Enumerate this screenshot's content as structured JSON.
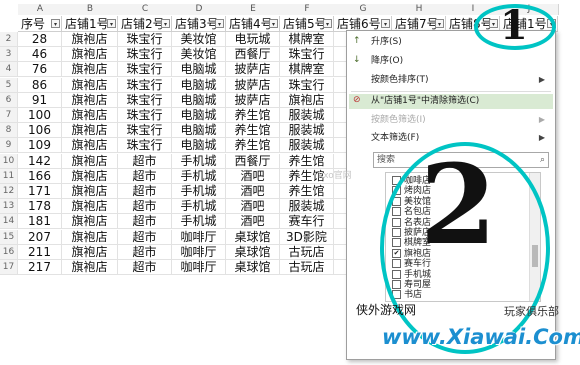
{
  "sheet": {
    "column_letters": [
      "A",
      "B",
      "C",
      "D",
      "E",
      "F",
      "G",
      "H",
      "I",
      "J"
    ],
    "headers": [
      "序号",
      "店铺1号",
      "店铺2号",
      "店铺3号",
      "店铺4号",
      "店铺5号",
      "店铺6号",
      "店铺7号",
      "店铺8号",
      "店铺1号"
    ],
    "row_numbers": [
      "2",
      "3",
      "4",
      "5",
      "6",
      "7",
      "8",
      "9",
      "10",
      "11",
      "12",
      "13",
      "14",
      "15",
      "16",
      "17"
    ],
    "rows": [
      [
        "28",
        "旗袍店",
        "珠宝行",
        "美妆馆",
        "电玩城",
        "棋牌室",
        "香"
      ],
      [
        "46",
        "旗袍店",
        "珠宝行",
        "美妆馆",
        "西餐厅",
        "珠宝行",
        "西"
      ],
      [
        "76",
        "旗袍店",
        "珠宝行",
        "电脑城",
        "披萨店",
        "棋牌室",
        "服"
      ],
      [
        "86",
        "旗袍店",
        "珠宝行",
        "电脑城",
        "披萨店",
        "珠宝行",
        "服"
      ],
      [
        "91",
        "旗袍店",
        "珠宝行",
        "电脑城",
        "披萨店",
        "旗袍店",
        "香"
      ],
      [
        "100",
        "旗袍店",
        "珠宝行",
        "电脑城",
        "养生馆",
        "服装城",
        "香"
      ],
      [
        "106",
        "旗袍店",
        "珠宝行",
        "电脑城",
        "养生馆",
        "服装城",
        "香"
      ],
      [
        "109",
        "旗袍店",
        "珠宝行",
        "电脑城",
        "养生馆",
        "服装城",
        "香"
      ],
      [
        "142",
        "旗袍店",
        "超市",
        "手机城",
        "西餐厅",
        "养生馆",
        "旗"
      ],
      [
        "166",
        "旗袍店",
        "超市",
        "手机城",
        "酒吧",
        "养生馆",
        "赛"
      ],
      [
        "171",
        "旗袍店",
        "超市",
        "手机城",
        "酒吧",
        "养生馆",
        "珠"
      ],
      [
        "178",
        "旗袍店",
        "超市",
        "手机城",
        "酒吧",
        "服装城",
        "珠"
      ],
      [
        "181",
        "旗袍店",
        "超市",
        "手机城",
        "酒吧",
        "赛车行",
        "珠"
      ],
      [
        "207",
        "旗袍店",
        "超市",
        "咖啡厅",
        "桌球馆",
        "3D影院",
        "棋"
      ],
      [
        "211",
        "旗袍店",
        "超市",
        "咖啡厅",
        "桌球馆",
        "古玩店",
        ""
      ],
      [
        "217",
        "旗袍店",
        "超市",
        "咖啡厅",
        "桌球馆",
        "古玩店",
        ""
      ]
    ]
  },
  "filter_menu": {
    "sort_asc": "升序(S)",
    "sort_desc": "降序(O)",
    "sort_by_color": "按颜色排序(T)",
    "clear_filter": "从\"店铺1号\"中清除筛选(C)",
    "filter_by_color": "按颜色筛选(I)",
    "text_filter": "文本筛选(F)",
    "search_placeholder": "搜索",
    "options": [
      {
        "label": "咖啡店",
        "checked": false
      },
      {
        "label": "烤肉店",
        "checked": false
      },
      {
        "label": "美妆馆",
        "checked": false
      },
      {
        "label": "名包店",
        "checked": false
      },
      {
        "label": "名表店",
        "checked": false
      },
      {
        "label": "披萨店",
        "checked": false
      },
      {
        "label": "棋牌室",
        "checked": false
      },
      {
        "label": "旗袍店",
        "checked": true
      },
      {
        "label": "赛车行",
        "checked": false
      },
      {
        "label": "手机城",
        "checked": false
      },
      {
        "label": "寿司屋",
        "checked": false
      },
      {
        "label": "书店",
        "checked": false
      }
    ],
    "check_mark": "✔"
  },
  "annotations": {
    "mark_one": "1",
    "mark_two": "2"
  },
  "watermark": {
    "site_name": "侠外游戏网",
    "club": "玩家俱乐部",
    "url": "www.Xiawai.Com",
    "corner": "kxo官网"
  },
  "colors": {
    "selected": "#d9ead3",
    "oval": "#00c4c4",
    "watermark_blue": "#1c8fd0"
  }
}
